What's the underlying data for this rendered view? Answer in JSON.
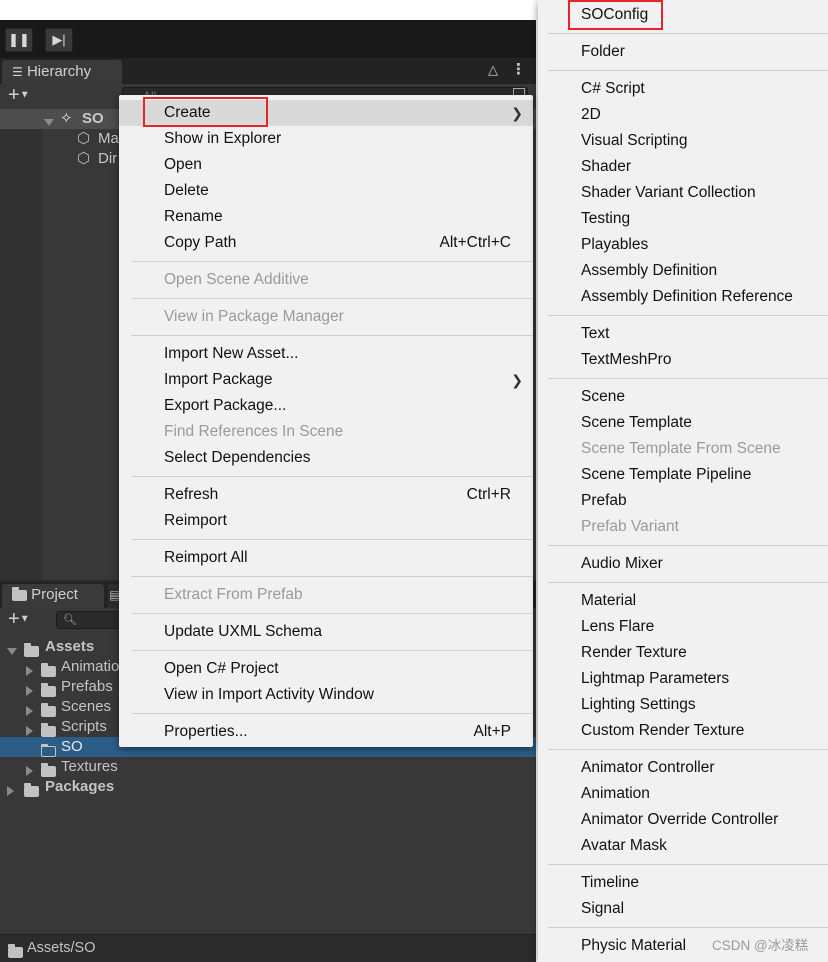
{
  "toolbar": {
    "pause_icon": "pause-icon",
    "step_icon": "step-icon"
  },
  "hierarchy": {
    "tab_label": "Hierarchy",
    "search_placeholder": "All",
    "scene": "SO",
    "children": [
      "Ma",
      "Dir"
    ]
  },
  "project": {
    "tab_label": "Project",
    "tree": [
      {
        "label": "Assets"
      },
      {
        "label": "Animatio"
      },
      {
        "label": "Prefabs"
      },
      {
        "label": "Scenes"
      },
      {
        "label": "Scripts"
      },
      {
        "label": "SO"
      },
      {
        "label": "Textures"
      },
      {
        "label": "Packages"
      }
    ],
    "status_path": "Assets/SO"
  },
  "context_menu": {
    "items": [
      {
        "label": "Create",
        "shortcut": "",
        "submenu": true,
        "disabled": false
      },
      {
        "label": "Show in Explorer",
        "shortcut": "",
        "disabled": false
      },
      {
        "label": "Open",
        "shortcut": "",
        "disabled": false
      },
      {
        "label": "Delete",
        "shortcut": "",
        "disabled": false
      },
      {
        "label": "Rename",
        "shortcut": "",
        "disabled": false
      },
      {
        "label": "Copy Path",
        "shortcut": "Alt+Ctrl+C",
        "disabled": false
      },
      {
        "label": "Open Scene Additive",
        "shortcut": "",
        "disabled": true
      },
      {
        "label": "View in Package Manager",
        "shortcut": "",
        "disabled": true
      },
      {
        "label": "Import New Asset...",
        "shortcut": "",
        "disabled": false
      },
      {
        "label": "Import Package",
        "shortcut": "",
        "submenu": true,
        "disabled": false
      },
      {
        "label": "Export Package...",
        "shortcut": "",
        "disabled": false
      },
      {
        "label": "Find References In Scene",
        "shortcut": "",
        "disabled": true
      },
      {
        "label": "Select Dependencies",
        "shortcut": "",
        "disabled": false
      },
      {
        "label": "Refresh",
        "shortcut": "Ctrl+R",
        "disabled": false
      },
      {
        "label": "Reimport",
        "shortcut": "",
        "disabled": false
      },
      {
        "label": "Reimport All",
        "shortcut": "",
        "disabled": false
      },
      {
        "label": "Extract From Prefab",
        "shortcut": "",
        "disabled": true
      },
      {
        "label": "Update UXML Schema",
        "shortcut": "",
        "disabled": false
      },
      {
        "label": "Open C# Project",
        "shortcut": "",
        "disabled": false
      },
      {
        "label": "View in Import Activity Window",
        "shortcut": "",
        "disabled": false
      },
      {
        "label": "Properties...",
        "shortcut": "Alt+P",
        "disabled": false
      }
    ]
  },
  "create_submenu": {
    "items": [
      {
        "label": "SOConfig",
        "disabled": false
      },
      {
        "label": "Folder",
        "disabled": false
      },
      {
        "label": "C# Script",
        "disabled": false
      },
      {
        "label": "2D",
        "disabled": false
      },
      {
        "label": "Visual Scripting",
        "disabled": false
      },
      {
        "label": "Shader",
        "disabled": false
      },
      {
        "label": "Shader Variant Collection",
        "disabled": false
      },
      {
        "label": "Testing",
        "disabled": false
      },
      {
        "label": "Playables",
        "disabled": false
      },
      {
        "label": "Assembly Definition",
        "disabled": false
      },
      {
        "label": "Assembly Definition Reference",
        "disabled": false
      },
      {
        "label": "Text",
        "disabled": false
      },
      {
        "label": "TextMeshPro",
        "disabled": false
      },
      {
        "label": "Scene",
        "disabled": false
      },
      {
        "label": "Scene Template",
        "disabled": false
      },
      {
        "label": "Scene Template From Scene",
        "disabled": true
      },
      {
        "label": "Scene Template Pipeline",
        "disabled": false
      },
      {
        "label": "Prefab",
        "disabled": false
      },
      {
        "label": "Prefab Variant",
        "disabled": true
      },
      {
        "label": "Audio Mixer",
        "disabled": false
      },
      {
        "label": "Material",
        "disabled": false
      },
      {
        "label": "Lens Flare",
        "disabled": false
      },
      {
        "label": "Render Texture",
        "disabled": false
      },
      {
        "label": "Lightmap Parameters",
        "disabled": false
      },
      {
        "label": "Lighting Settings",
        "disabled": false
      },
      {
        "label": "Custom Render Texture",
        "disabled": false
      },
      {
        "label": "Animator Controller",
        "disabled": false
      },
      {
        "label": "Animation",
        "disabled": false
      },
      {
        "label": "Animator Override Controller",
        "disabled": false
      },
      {
        "label": "Avatar Mask",
        "disabled": false
      },
      {
        "label": "Timeline",
        "disabled": false
      },
      {
        "label": "Signal",
        "disabled": false
      },
      {
        "label": "Physic Material",
        "disabled": false
      }
    ]
  },
  "watermark": "CSDN @冰凌糕",
  "colors": {
    "highlight_box": "#e6252a",
    "selection": "#2c5d87",
    "menu_bg": "#f1f1f1"
  }
}
